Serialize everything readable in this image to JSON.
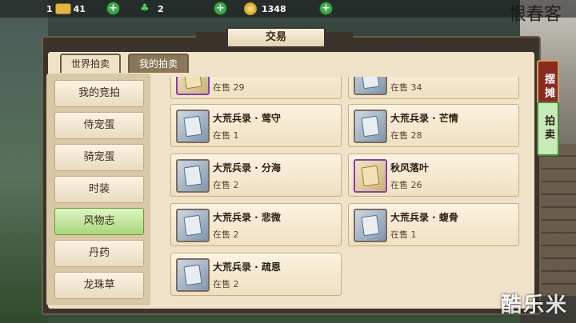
{
  "resources": {
    "level_prefix": "1",
    "gold": "41",
    "clover": "2",
    "coins": "1348"
  },
  "panel": {
    "title": "交易",
    "tabs": [
      "世界拍卖",
      "我的拍卖"
    ]
  },
  "categories": [
    {
      "label": "我的竞拍",
      "active": false
    },
    {
      "label": "侍宠蛋",
      "active": false
    },
    {
      "label": "骑宠蛋",
      "active": false
    },
    {
      "label": "时装",
      "active": false
    },
    {
      "label": "风物志",
      "active": true
    },
    {
      "label": "丹药",
      "active": false
    },
    {
      "label": "龙珠草",
      "active": false
    }
  ],
  "items": [
    {
      "name": "",
      "stock": "在售 29",
      "icon": "scroll-gold-icon"
    },
    {
      "name": "",
      "stock": "在售 34",
      "icon": "book-icon"
    },
    {
      "name": "大荒兵录 · 莺守",
      "stock": "在售 1",
      "icon": "book-icon"
    },
    {
      "name": "大荒兵录 · 芒情",
      "stock": "在售 28",
      "icon": "book-icon"
    },
    {
      "name": "大荒兵录 · 分海",
      "stock": "在售 2",
      "icon": "book-icon"
    },
    {
      "name": "秋风落叶",
      "stock": "在售 26",
      "icon": "scroll-gold-icon"
    },
    {
      "name": "大荒兵录 · 悲微",
      "stock": "在售 2",
      "icon": "book-icon"
    },
    {
      "name": "大荒兵录 · 蝮骨",
      "stock": "在售 1",
      "icon": "book-icon"
    },
    {
      "name": "大荒兵录 · 疏恩",
      "stock": "在售 2",
      "icon": "book-icon"
    }
  ],
  "side_tabs": {
    "stall": "摆摊",
    "auction": "拍卖"
  },
  "calligraphy": "恨春客",
  "watermark": "酷乐米"
}
